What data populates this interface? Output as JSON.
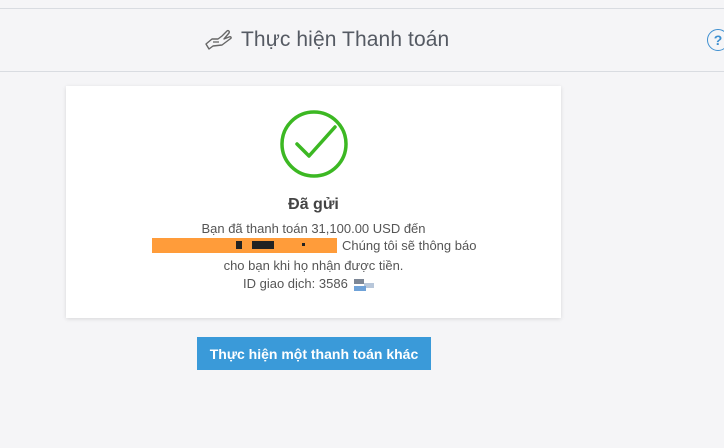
{
  "header": {
    "title": "Thực hiện Thanh toán",
    "icon": "hand-payment-icon",
    "help_icon": "help-icon",
    "help_symbol": "?"
  },
  "card": {
    "status_icon": "check-circle-icon",
    "status_color": "#3cb823",
    "title": "Đã gửi",
    "line1": "Bạn đã thanh toán 31,100.00 USD đến",
    "line2": "Chúng tôi sẽ thông báo",
    "line3": "cho bạn khi họ nhận được tiền.",
    "transaction_id_label": "ID giao dịch: 3586"
  },
  "actions": {
    "new_payment_label": "Thực hiện một thanh toán khác"
  },
  "colors": {
    "accent": "#3a9ad9",
    "success": "#3cb823",
    "redaction": "#ff9c3a"
  }
}
